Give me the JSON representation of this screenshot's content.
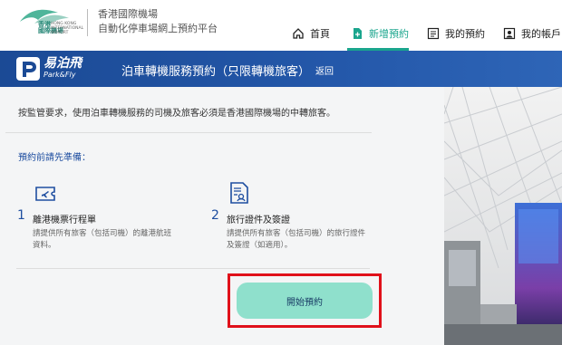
{
  "header": {
    "logo_zh": "香港\n國際機場",
    "logo_en": "HONG KONG\nINTERNATIONAL\nAIRPORT",
    "site_title_line1": "香港國際機場",
    "site_title_line2": "自動化停車場網上預約平台",
    "nav": [
      {
        "label": "首頁",
        "icon": "home-icon",
        "active": false
      },
      {
        "label": "新增預約",
        "icon": "add-document-icon",
        "active": true
      },
      {
        "label": "我的預約",
        "icon": "list-icon",
        "active": false
      },
      {
        "label": "我的帳戶",
        "icon": "account-icon",
        "active": false
      }
    ]
  },
  "banner": {
    "brand_zh": "易泊飛",
    "brand_en": "Park&Fly",
    "title": "泊車轉機服務預約（只限轉機旅客）",
    "back_label": "返回"
  },
  "main": {
    "notice": "按監管要求，使用泊車轉機服務的司機及旅客必須是香港國際機場的中轉旅客。",
    "prep_title": "預約前請先準備：",
    "items": [
      {
        "num": "1",
        "title": "離港機票行程單",
        "desc_line1": "請提供所有旅客（包括司機）的離港航班",
        "desc_line2": "資料。",
        "icon": "ticket-icon"
      },
      {
        "num": "2",
        "title": "旅行證件及簽證",
        "desc_line1": "請提供所有旅客（包括司機）的旅行證件",
        "desc_line2": "及簽證（如適用）。",
        "icon": "document-id-icon"
      }
    ],
    "start_button": "開始預約"
  },
  "colors": {
    "accent": "#1aa58d",
    "banner": "#1b4a95",
    "button": "#8fe0cc",
    "highlight_frame": "#e0101a"
  }
}
